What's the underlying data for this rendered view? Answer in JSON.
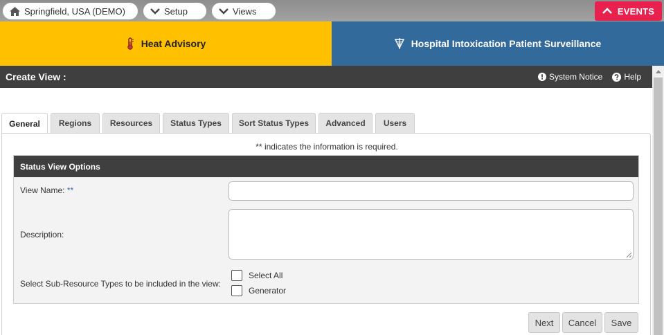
{
  "topbar": {
    "location": "Springfield, USA (DEMO)",
    "setup_label": "Setup",
    "views_label": "Views",
    "events_label": "EVENTS"
  },
  "banners": {
    "heat": "Heat Advisory",
    "hospital": "Hospital Intoxication Patient Surveillance"
  },
  "titlebar": {
    "title": "Create View :",
    "system_notice": "System Notice",
    "help": "Help"
  },
  "tabs": [
    {
      "label": "General"
    },
    {
      "label": "Regions"
    },
    {
      "label": "Resources"
    },
    {
      "label": "Status Types"
    },
    {
      "label": "Sort Status Types"
    },
    {
      "label": "Advanced"
    },
    {
      "label": "Users"
    }
  ],
  "form": {
    "required_note": "** indicates the information is required.",
    "section_title": "Status View Options",
    "view_name_label": "View Name:",
    "required_marker": "**",
    "view_name_value": "",
    "description_label": "Description:",
    "description_value": "",
    "subresource_label": "Select Sub-Resource Types to be included in the view:",
    "checkboxes": [
      {
        "label": "Select All",
        "checked": false
      },
      {
        "label": "Generator",
        "checked": false
      }
    ]
  },
  "buttons": {
    "next": "Next",
    "cancel": "Cancel",
    "save": "Save"
  },
  "colors": {
    "events": "#e8214e",
    "heat_banner": "#ffc000",
    "hospital_banner": "#336a9c",
    "titlebar": "#3f3f3f"
  }
}
